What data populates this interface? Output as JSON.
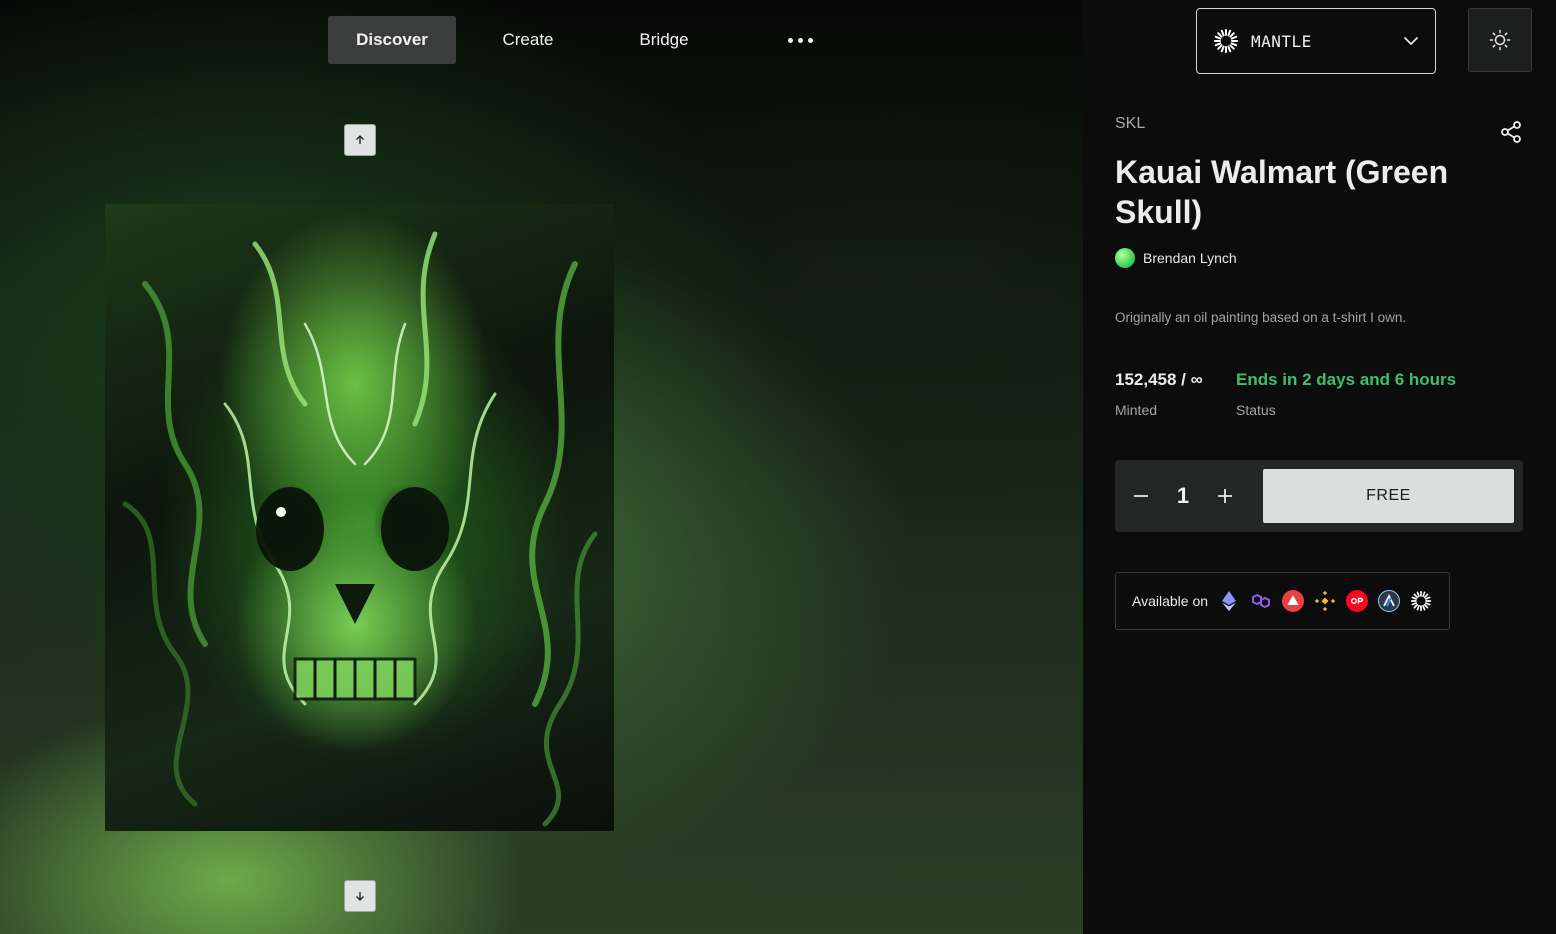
{
  "nav": {
    "discover": "Discover",
    "create": "Create",
    "bridge": "Bridge"
  },
  "network": {
    "name": "MANTLE"
  },
  "token": {
    "symbol": "SKL",
    "title": "Kauai Walmart (Green Skull)",
    "creator": "Brendan Lynch",
    "description": "Originally an oil painting based on a t-shirt I own."
  },
  "stats": {
    "minted_value": "152,458 / ∞",
    "minted_label": "Minted",
    "status_value": "Ends in 2 days and 6 hours",
    "status_label": "Status"
  },
  "mint": {
    "quantity": "1",
    "price_label": "FREE"
  },
  "availability": {
    "label": "Available on",
    "chains": [
      "ethereum-icon",
      "polygon-icon",
      "avalanche-icon",
      "bnb-icon",
      "optimism-icon",
      "arbitrum-icon",
      "mantle-icon"
    ]
  },
  "colors": {
    "accent_green": "#3fbf6a",
    "panel_bg": "#0c0c0c",
    "mint_button": "#dadfde"
  }
}
